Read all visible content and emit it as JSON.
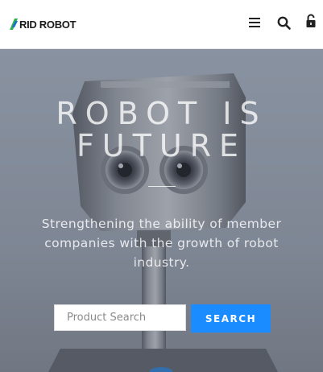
{
  "header": {
    "logo_text": "RID ROBOT",
    "icons": [
      "menu-icon",
      "search-icon",
      "lock-icon"
    ]
  },
  "hero": {
    "title": "ROBOT IS FUTURE",
    "subtitle": "Strengthening the ability of member companies with the growth of robot industry.",
    "search": {
      "placeholder": "Product Search",
      "value": "",
      "button_label": "SEARCH"
    }
  },
  "colors": {
    "accent": "#1a8cff",
    "logo_green": "#2bb24c",
    "logo_blue": "#1a6fd1"
  }
}
